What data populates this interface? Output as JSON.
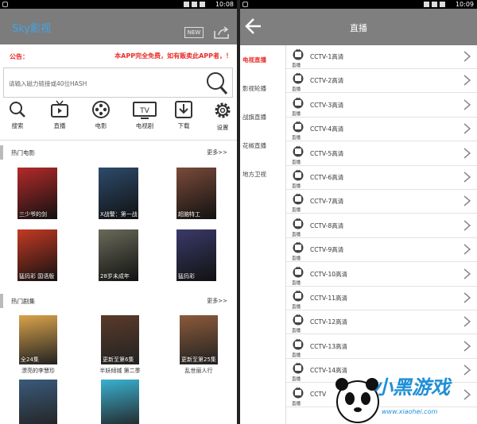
{
  "status": {
    "time": "10:08",
    "time_right": "10:09"
  },
  "left": {
    "app_title": "Sky影视",
    "new_label": "NEW",
    "notice_label": "公告：",
    "notice_text": "本APP完全免费，如有贩卖此APP者，！",
    "search_placeholder": "请输入磁力链接或40位HASH",
    "nav": [
      {
        "icon": "search-icon",
        "label": "搜索"
      },
      {
        "icon": "tv-live-icon",
        "label": "直播"
      },
      {
        "icon": "film-reel-icon",
        "label": "电影"
      },
      {
        "icon": "tv-icon",
        "label": "电视剧"
      },
      {
        "icon": "download-icon",
        "label": "下载"
      },
      {
        "icon": "gear-icon",
        "label": "设置"
      }
    ],
    "hot_movies": {
      "title": "热门电影",
      "more": "更多>>",
      "items": [
        {
          "caption": "三少爷的剑",
          "color": "#b42a2a"
        },
        {
          "caption": "X战警：第一战",
          "color": "#2d4b6b"
        },
        {
          "caption": "超脑特工",
          "color": "#7a4b3a"
        },
        {
          "caption": "猛犸彩 国语版",
          "color": "#c43a24"
        },
        {
          "caption": "28岁未成年",
          "color": "#6a6a5a"
        },
        {
          "caption": "猛犸彩",
          "color": "#3a3a6a"
        }
      ]
    },
    "hot_shows": {
      "title": "热门剧集",
      "more": "更多>>",
      "items": [
        {
          "title": "漂亮的李慧珍",
          "badge": "全24集",
          "color": "#d8a24a"
        },
        {
          "title": "半妖倾城 第二季",
          "badge": "更新至第6集",
          "color": "#5a3a2a"
        },
        {
          "title": "乱世丽人行",
          "badge": "更新至第25集",
          "color": "#8a5a3a"
        },
        {
          "title": "",
          "badge": "",
          "color": "#3a5a7a"
        },
        {
          "title": "",
          "badge": "",
          "color": "#3ab0d0"
        }
      ]
    }
  },
  "right": {
    "title": "直播",
    "categories": [
      {
        "label": "电视直播",
        "active": true
      },
      {
        "label": "影视轮播",
        "active": false
      },
      {
        "label": "战旗直播",
        "active": false
      },
      {
        "label": "花椒直播",
        "active": false
      },
      {
        "label": "地方卫视",
        "active": false
      }
    ],
    "tag": "直播",
    "channels": [
      "CCTV-1高清",
      "CCTV-2高清",
      "CCTV-3高清",
      "CCTV-4高清",
      "CCTV-5高清",
      "CCTV-6高清",
      "CCTV-7高清",
      "CCTV-8高清",
      "CCTV-9高清",
      "CCTV-10高清",
      "CCTV-11高清",
      "CCTV-12高清",
      "CCTV-13高清",
      "CCTV-14高清",
      "CCTV"
    ]
  },
  "watermark": {
    "text": "小黑游戏",
    "url": "www.xiaohei.com"
  },
  "colors": {
    "accent_red": "#e8302a",
    "title_blue": "#3fa6e8",
    "appbar": "#7c7c7c"
  }
}
